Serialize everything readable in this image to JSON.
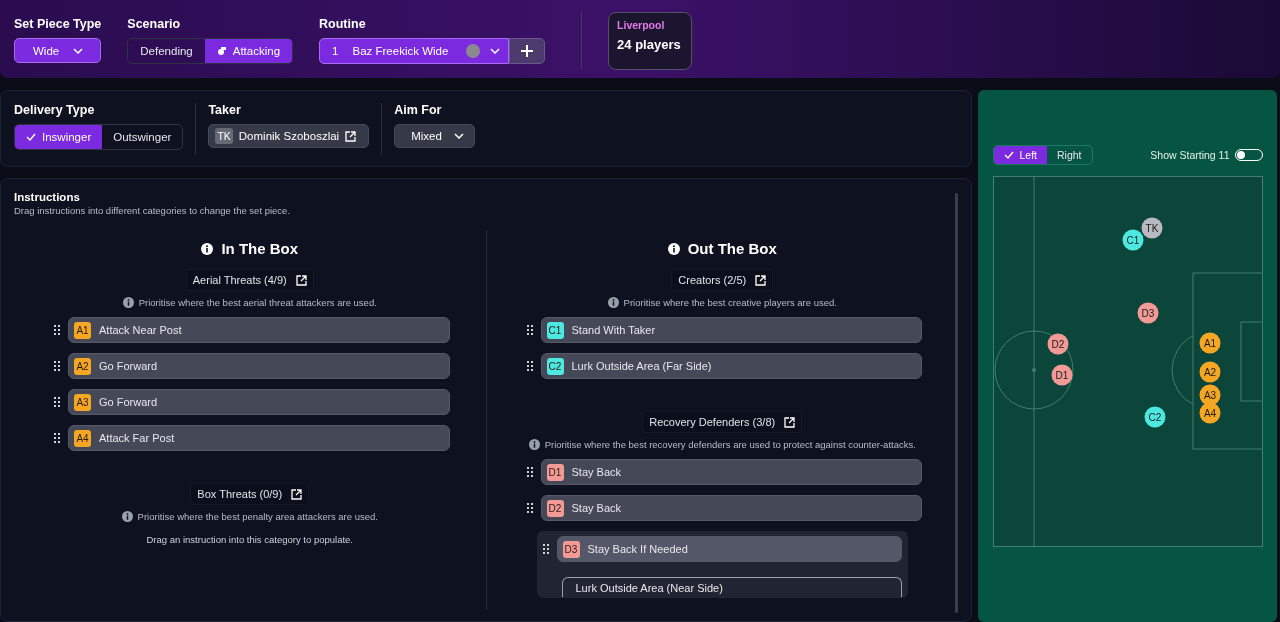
{
  "top_bar": {
    "set_piece_type": {
      "label": "Set Piece Type",
      "value": "Wide"
    },
    "scenario": {
      "label": "Scenario",
      "options": [
        {
          "label": "Defending",
          "selected": false
        },
        {
          "label": "Attacking",
          "selected": true
        }
      ]
    },
    "routine": {
      "label": "Routine",
      "number": "1",
      "name": "Baz Freekick Wide"
    },
    "team": {
      "name": "Liverpool",
      "count": "24 players"
    }
  },
  "delivery": {
    "delivery_type": {
      "label": "Delivery Type",
      "options": [
        {
          "label": "Inswinger",
          "selected": true
        },
        {
          "label": "Outswinger",
          "selected": false
        }
      ]
    },
    "taker": {
      "label": "Taker",
      "badge": "TK",
      "name": "Dominik Szoboszlai"
    },
    "aim_for": {
      "label": "Aim For",
      "value": "Mixed"
    }
  },
  "instructions": {
    "title": "Instructions",
    "subtitle": "Drag instructions into different categories to change the set piece.",
    "columns": [
      {
        "title": "In The Box",
        "sections": [
          {
            "title": "Aerial Threats (4/9)",
            "hint": "Prioritise where the best aerial threat attackers are used.",
            "items": [
              {
                "badge": "A1",
                "color": "#f5a623",
                "label": "Attack Near Post",
                "expanded": false
              },
              {
                "badge": "A2",
                "color": "#f5a623",
                "label": "Go Forward",
                "expanded": false
              },
              {
                "badge": "A3",
                "color": "#f5a623",
                "label": "Go Forward",
                "expanded": false
              },
              {
                "badge": "A4",
                "color": "#f5a623",
                "label": "Attack Far Post",
                "expanded": false
              }
            ]
          },
          {
            "title": "Box Threats (0/9)",
            "hint": "Prioritise where the best penalty area attackers are used.",
            "empty_text": "Drag an instruction into this category to populate."
          }
        ]
      },
      {
        "title": "Out The Box",
        "sections": [
          {
            "title": "Creators (2/5)",
            "hint": "Prioritise where the best creative players are used.",
            "items": [
              {
                "badge": "C1",
                "color": "#4de8e0",
                "label": "Stand With Taker",
                "expanded": false
              },
              {
                "badge": "C2",
                "color": "#4de8e0",
                "label": "Lurk Outside Area (Far Side)",
                "expanded": false
              }
            ]
          },
          {
            "title": "Recovery Defenders (3/8)",
            "hint": "Prioritise where the best recovery defenders are used to protect against counter-attacks.",
            "items": [
              {
                "badge": "D1",
                "color": "#f29a96",
                "label": "Stay Back",
                "expanded": false
              },
              {
                "badge": "D2",
                "color": "#f29a96",
                "label": "Stay Back",
                "expanded": false
              },
              {
                "badge": "D3",
                "color": "#f29a96",
                "label": "Stay Back If Needed",
                "expanded": true,
                "options": [
                  "Lurk Outside Area (Near Side)"
                ]
              }
            ]
          }
        ]
      }
    ]
  },
  "pitch": {
    "sides": [
      {
        "label": "Left",
        "selected": true
      },
      {
        "label": "Right",
        "selected": false
      }
    ],
    "show_starting_11": {
      "label": "Show Starting 11",
      "on": false
    },
    "markers": [
      {
        "label": "TK",
        "color": "#b9b9c0"
      },
      {
        "label": "C1",
        "color": "#4de8e0"
      },
      {
        "label": "D3",
        "color": "#f29a96"
      },
      {
        "label": "D2",
        "color": "#f29a96"
      },
      {
        "label": "D1",
        "color": "#f29a96"
      },
      {
        "label": "A1",
        "color": "#f5a623"
      },
      {
        "label": "A2",
        "color": "#f5a623"
      },
      {
        "label": "A3",
        "color": "#f5a623"
      },
      {
        "label": "A4",
        "color": "#f5a623"
      },
      {
        "label": "C2",
        "color": "#4de8e0"
      }
    ]
  }
}
